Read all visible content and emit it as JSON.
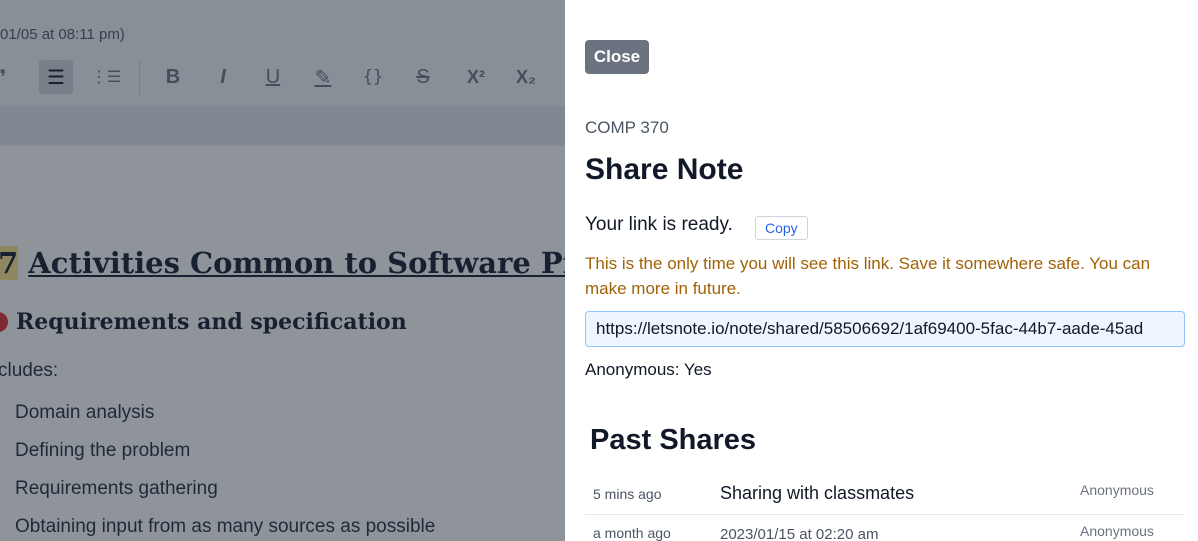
{
  "editor": {
    "meta_text": "01/05 at 08:11 pm)",
    "toolbar": [
      {
        "name": "blockquote-icon",
        "glyph": "❞"
      },
      {
        "name": "bullet-list-icon",
        "glyph": "☰"
      },
      {
        "name": "numbered-list-icon",
        "glyph": "⋮☰"
      },
      {
        "name": "bold-icon",
        "glyph": "B"
      },
      {
        "name": "italic-icon",
        "glyph": "I"
      },
      {
        "name": "underline-icon",
        "glyph": "U"
      },
      {
        "name": "highlight-icon",
        "glyph": "✎"
      },
      {
        "name": "code-icon",
        "glyph": "{}"
      },
      {
        "name": "strikethrough-icon",
        "glyph": "S"
      },
      {
        "name": "superscript-icon",
        "glyph": "X²"
      },
      {
        "name": "subscript-icon",
        "glyph": "X₂"
      }
    ],
    "heading_number": "7",
    "heading_title": "Activities Common to Software Proj",
    "subheading": "Requirements and specification",
    "includes_label": "cludes:",
    "list_items": [
      "Domain analysis",
      "Defining the problem",
      "Requirements gathering",
      "Obtaining input from as many sources as possible"
    ]
  },
  "panel": {
    "close_label": "Close",
    "course": "COMP 370",
    "title": "Share Note",
    "ready_text": "Your link is ready.",
    "copy_label": "Copy",
    "warning": "This is the only time you will see this link. Save it somewhere safe. You can make more in future.",
    "link": "https://letsnote.io/note/shared/58506692/1af69400-5fac-44b7-aade-45ad",
    "anonymous_text": "Anonymous: Yes",
    "past_title": "Past Shares",
    "past_shares": [
      {
        "ago": "5 mins ago",
        "name": "Sharing with classmates",
        "visibility": "Anonymous"
      },
      {
        "ago": "a month ago",
        "name": "2023/01/15 at 02:20 am",
        "visibility": "Anonymous"
      }
    ]
  },
  "colors": {
    "close_button": "#6b7280",
    "warning_text": "#a16207",
    "link_box_bg": "#eff6ff",
    "copy_text": "#2563eb"
  }
}
